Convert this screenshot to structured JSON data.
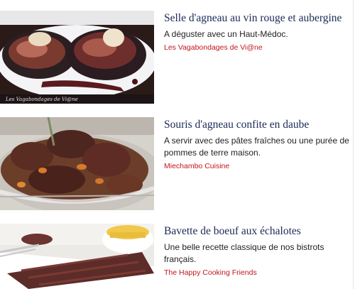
{
  "recipes": [
    {
      "title": "Selle d'agneau au vin rouge et aubergine",
      "description": "A déguster avec un Haut-Médoc.",
      "source": "Les Vagabondages de Vi@ne",
      "image_watermark": "Les Vagabondages de Vi@ne"
    },
    {
      "title": "Souris d'agneau confite en daube",
      "description": "A servir avec des pâtes fraîches ou une purée de pommes de terre maison.",
      "source": "Miechambo Cuisine"
    },
    {
      "title": "Bavette de boeuf aux échalotes",
      "description": "Une belle recette classique de nos bistrots français.",
      "source": "The Happy Cooking Friends"
    }
  ],
  "colors": {
    "title": "#1a2a55",
    "source": "#c4161c",
    "text": "#222222"
  }
}
